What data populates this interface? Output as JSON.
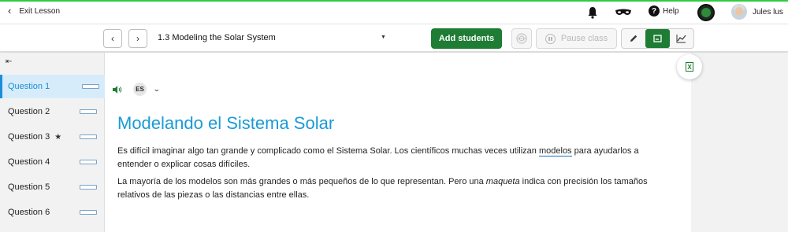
{
  "topbar": {
    "exit_label": "Exit Lesson",
    "help_label": "Help",
    "user_name": "Jules lus",
    "accent_color": "#2ecc40"
  },
  "toolbar": {
    "prev_icon": "‹",
    "next_icon": "›",
    "lesson_title": "1.3 Modeling the Solar System",
    "add_students_label": "Add students",
    "pause_label": "Pause class",
    "primary_color": "#1e7c35"
  },
  "sidebar": {
    "collapse_icon": "⇤",
    "items": [
      {
        "label": "Question 1",
        "active": true
      },
      {
        "label": "Question 2"
      },
      {
        "label": "Question 3",
        "starred": true
      },
      {
        "label": "Question 4"
      },
      {
        "label": "Question 5"
      },
      {
        "label": "Question 6"
      }
    ],
    "star_icon": "★"
  },
  "content": {
    "language_code": "ES",
    "heading": "Modelando el Sistema Solar",
    "para1_before": "Es difícil imaginar algo tan grande y complicado como el Sistema Solar. Los científicos muchas veces utilizan ",
    "para1_term": "modelos",
    "para1_after": " para ayudarlos a entender o explicar cosas difíciles.",
    "para2_before": "La mayoría de los modelos son más grandes o más pequeños de lo que representan. Pero una ",
    "para2_em": "maqueta",
    "para2_after": " indica con precisión los tamaños relativos de las piezas o las distancias entre ellas.",
    "heading_color": "#1a9ad6"
  }
}
